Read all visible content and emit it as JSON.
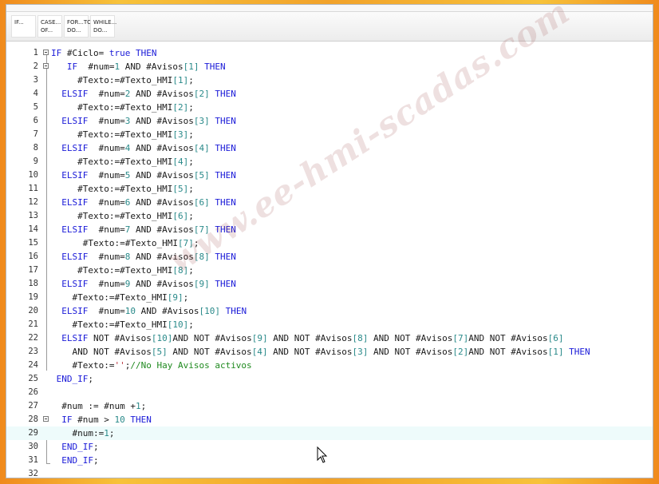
{
  "toolbar": {
    "buttons": [
      {
        "label": "IF..."
      },
      {
        "label": "CASE...\nOF..."
      },
      {
        "label": "FOR...TO\nDO..."
      },
      {
        "label": "WHILE...\nDO..."
      }
    ]
  },
  "editor": {
    "lines": [
      {
        "n": "1",
        "html": "<span class=\"kw\">IF</span> #Ciclo= <span class=\"kw\">true</span> <span class=\"kw\">THEN</span>"
      },
      {
        "n": "2",
        "html": "   <span class=\"kw\">IF</span>  #num=<span class=\"num\">1</span> AND #Avisos<span class=\"num\">[1]</span> <span class=\"kw\">THEN</span>"
      },
      {
        "n": "3",
        "html": "     #Texto:=#Texto_HMI<span class=\"num\">[1]</span>;"
      },
      {
        "n": "4",
        "html": "  <span class=\"kw\">ELSIF</span>  #num=<span class=\"num\">2</span> AND #Avisos<span class=\"num\">[2]</span> <span class=\"kw\">THEN</span>"
      },
      {
        "n": "5",
        "html": "     #Texto:=#Texto_HMI<span class=\"num\">[2]</span>;"
      },
      {
        "n": "6",
        "html": "  <span class=\"kw\">ELSIF</span>  #num=<span class=\"num\">3</span> AND #Avisos<span class=\"num\">[3]</span> <span class=\"kw\">THEN</span>"
      },
      {
        "n": "7",
        "html": "     #Texto:=#Texto_HMI<span class=\"num\">[3]</span>;"
      },
      {
        "n": "8",
        "html": "  <span class=\"kw\">ELSIF</span>  #num=<span class=\"num\">4</span> AND #Avisos<span class=\"num\">[4]</span> <span class=\"kw\">THEN</span>"
      },
      {
        "n": "9",
        "html": "     #Texto:=#Texto_HMI<span class=\"num\">[4]</span>;"
      },
      {
        "n": "10",
        "html": "  <span class=\"kw\">ELSIF</span>  #num=<span class=\"num\">5</span> AND #Avisos<span class=\"num\">[5]</span> <span class=\"kw\">THEN</span>"
      },
      {
        "n": "11",
        "html": "     #Texto:=#Texto_HMI<span class=\"num\">[5]</span>;"
      },
      {
        "n": "12",
        "html": "  <span class=\"kw\">ELSIF</span>  #num=<span class=\"num\">6</span> AND #Avisos<span class=\"num\">[6]</span> <span class=\"kw\">THEN</span>"
      },
      {
        "n": "13",
        "html": "     #Texto:=#Texto_HMI<span class=\"num\">[6]</span>;"
      },
      {
        "n": "14",
        "html": "  <span class=\"kw\">ELSIF</span>  #num=<span class=\"num\">7</span> AND #Avisos<span class=\"num\">[7]</span> <span class=\"kw\">THEN</span>"
      },
      {
        "n": "15",
        "html": "      #Texto:=#Texto_HMI<span class=\"num\">[7]</span>;"
      },
      {
        "n": "16",
        "html": "  <span class=\"kw\">ELSIF</span>  #num=<span class=\"num\">8</span> AND #Avisos<span class=\"num\">[8]</span> <span class=\"kw\">THEN</span>"
      },
      {
        "n": "17",
        "html": "     #Texto:=#Texto_HMI<span class=\"num\">[8]</span>;"
      },
      {
        "n": "18",
        "html": "  <span class=\"kw\">ELSIF</span>  #num=<span class=\"num\">9</span> AND #Avisos<span class=\"num\">[9]</span> <span class=\"kw\">THEN</span>"
      },
      {
        "n": "19",
        "html": "    #Texto:=#Texto_HMI<span class=\"num\">[9]</span>;"
      },
      {
        "n": "20",
        "html": "  <span class=\"kw\">ELSIF</span>  #num=<span class=\"num\">10</span> AND #Avisos<span class=\"num\">[10]</span> <span class=\"kw\">THEN</span>"
      },
      {
        "n": "21",
        "html": "    #Texto:=#Texto_HMI<span class=\"num\">[10]</span>;"
      },
      {
        "n": "22",
        "html": "  <span class=\"kw\">ELSIF</span> NOT #Avisos<span class=\"num\">[10]</span>AND NOT #Avisos<span class=\"num\">[9]</span> AND NOT #Avisos<span class=\"num\">[8]</span> AND NOT #Avisos<span class=\"num\">[7]</span>AND NOT #Avisos<span class=\"num\">[6]</span>"
      },
      {
        "n": "23",
        "html": "    AND NOT #Avisos<span class=\"num\">[5]</span> AND NOT #Avisos<span class=\"num\">[4]</span> AND NOT #Avisos<span class=\"num\">[3]</span> AND NOT #Avisos<span class=\"num\">[2]</span>AND NOT #Avisos<span class=\"num\">[1]</span> <span class=\"kw\">THEN</span>"
      },
      {
        "n": "24",
        "html": "    #Texto:=<span class=\"str\">''</span>;<span class=\"cmt\">//No Hay Avisos activos</span>"
      },
      {
        "n": "25",
        "html": " <span class=\"kw\">END_IF</span>;"
      },
      {
        "n": "26",
        "html": ""
      },
      {
        "n": "27",
        "html": "  #num := #num +<span class=\"num\">1</span>;"
      },
      {
        "n": "28",
        "html": "  <span class=\"kw\">IF</span> #num &gt; <span class=\"num\">10</span> <span class=\"kw\">THEN</span>"
      },
      {
        "n": "29",
        "html": "    #num:=<span class=\"num\">1</span>;"
      },
      {
        "n": "30",
        "html": "  <span class=\"kw\">END_IF</span>;"
      },
      {
        "n": "31",
        "html": "  <span class=\"kw\">END_IF</span>;"
      },
      {
        "n": "32",
        "html": ""
      }
    ],
    "highlighted_line": "29"
  },
  "watermark": "www.ee-hmi-scadas.com"
}
